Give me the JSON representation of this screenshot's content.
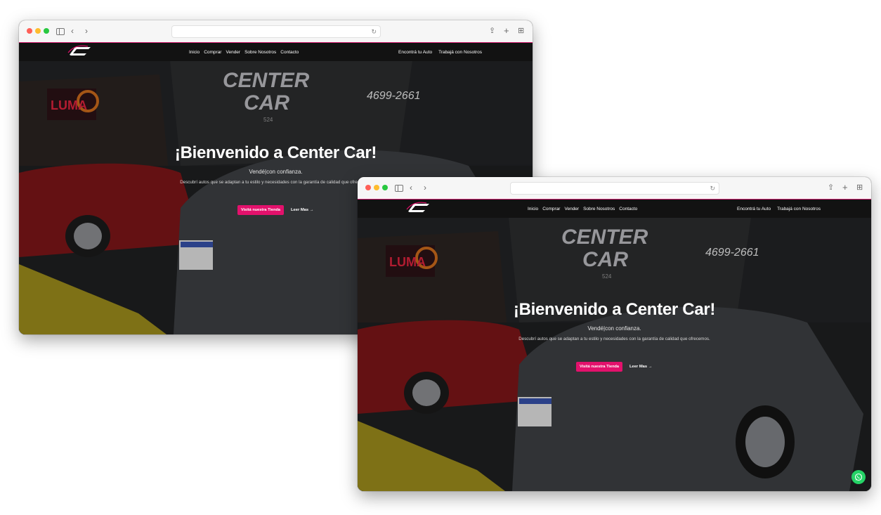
{
  "nav": {
    "menu": [
      "Inicio",
      "Comprar",
      "Vender",
      "Sobre Nosotros",
      "Contacto"
    ],
    "right_menu": [
      "Encontrá tu Auto",
      "Trabajá con Nosotros"
    ]
  },
  "hero": {
    "title": "¡Bienvenido a Center Car!",
    "subtitle": "Vendé|con confianza.",
    "description": "Descubrí autos que se adaptan a tu estilo y necesidades con la garantía de calidad que ofrecemos.",
    "primary_button": "Visitá nuestra Tienda",
    "secondary_button": "Leer Mas →",
    "sign_line1": "CENTER",
    "sign_line2": "CAR",
    "sign_phone": "4699-2661",
    "sign_number": "524",
    "store_name": "LUMA"
  },
  "colors": {
    "accent": "#e3116c",
    "nav_bg": "#121212",
    "whatsapp": "#25d366"
  },
  "icons": {
    "reload": "↻",
    "back": "‹",
    "forward": "›",
    "share": "⇪",
    "new_tab": "+",
    "tab_overview": "⊞"
  }
}
